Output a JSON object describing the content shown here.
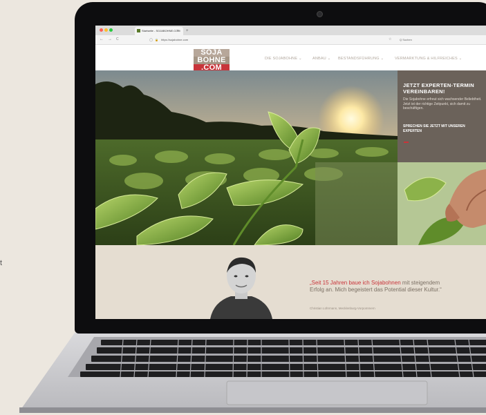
{
  "browser": {
    "tab_title": "Startseite - SOJABOHNE.COM",
    "tab_close": "×",
    "new_tab": "+",
    "url": "https://sojabohne.com",
    "search_placeholder": "Q Suchen",
    "nav_back": "←",
    "nav_forward": "→",
    "nav_reload": "C",
    "shield": "◯",
    "lock": "🔒",
    "star": "☆"
  },
  "site": {
    "logo": {
      "line1": "SOJA",
      "line2": "BOHNE",
      "line3": ".COM"
    },
    "nav": [
      "DIE SOJABOHNE ⌄",
      "ANBAU ⌄",
      "BESTANDSFÜHRUNG ⌄",
      "VERMARKTUNG & HILFREICHES ⌄"
    ],
    "cta": {
      "heading": "JETZT EXPERTEN-TERMIN VEREINBAREN!",
      "text": "Die Sojabohne erfreut sich wachsender Beliebtheit. Jetzt ist der richtige Zeitpunkt, sich damit zu beschäftigen.",
      "link": "SPRECHEN SIE JETZT MIT UNSEREN EXPERTEN"
    },
    "quote": {
      "highlight": "„Seit 15 Jahren baue ich Sojabohnen",
      "rest": " mit steigendem Erfolg an. Mich begeistert das Potential dieser Kultur.“",
      "author": "Christian Lührmann, Mecklenburg-Vorpommern"
    }
  },
  "page": {
    "side_letter": "t"
  },
  "colors": {
    "brand_red": "#c8343a",
    "cta_bg": "#6b625a",
    "quote_bg": "#e5ddd1",
    "laptop_bezel": "#0d0d0f"
  }
}
